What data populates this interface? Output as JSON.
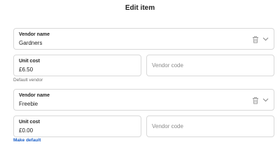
{
  "header": {
    "title": "Edit item"
  },
  "vendors": [
    {
      "name_label": "Vendor name",
      "name_value": "Gardners",
      "cost_label": "Unit cost",
      "cost_value": "£6.50",
      "code_placeholder": "Vendor code",
      "footer_text": "Default vendor"
    },
    {
      "name_label": "Vendor name",
      "name_value": "Freebie",
      "cost_label": "Unit cost",
      "cost_value": "£0.00",
      "code_placeholder": "Vendor code",
      "footer_link": "Make default"
    }
  ],
  "icons": {
    "delete": "trash-icon",
    "expand": "chevron-down-icon"
  },
  "colors": {
    "link": "#1a5fc8",
    "border": "#d9d9d9",
    "muted": "#8a8a8a"
  }
}
